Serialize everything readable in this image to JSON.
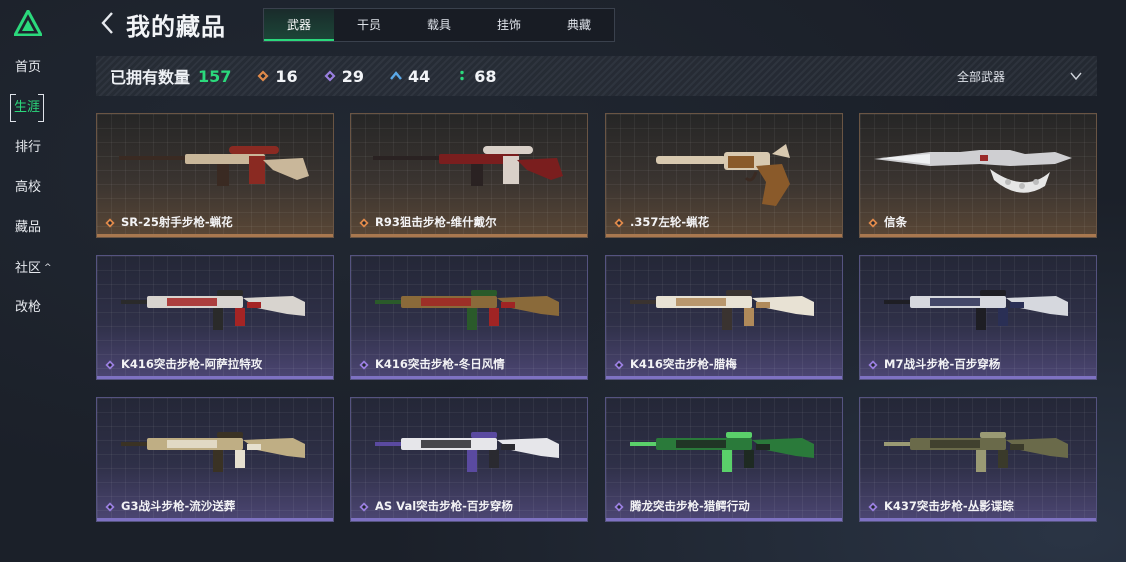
{
  "sidebar": {
    "items": [
      {
        "label": "首页",
        "active": false
      },
      {
        "label": "生涯",
        "active": true
      },
      {
        "label": "排行",
        "active": false
      },
      {
        "label": "高校",
        "active": false
      },
      {
        "label": "藏品",
        "active": false
      },
      {
        "label": "社区",
        "active": false,
        "caret": "^"
      },
      {
        "label": "改枪",
        "active": false
      }
    ]
  },
  "header": {
    "title": "我的藏品",
    "tabs": [
      {
        "label": "武器",
        "active": true
      },
      {
        "label": "干员",
        "active": false
      },
      {
        "label": "载具",
        "active": false
      },
      {
        "label": "挂饰",
        "active": false
      },
      {
        "label": "典藏",
        "active": false
      }
    ]
  },
  "summary": {
    "owned_label": "已拥有数量",
    "owned_total": "157",
    "counts": [
      {
        "icon": "orange-diamond-icon",
        "value": "16",
        "color": "#e08a4a"
      },
      {
        "icon": "purple-diamond-icon",
        "value": "29",
        "color": "#9a7fe0"
      },
      {
        "icon": "blue-chevron-icon",
        "value": "44",
        "color": "#5aa8e8"
      },
      {
        "icon": "green-dots-icon",
        "value": "68",
        "color": "#2bd97c"
      }
    ],
    "filter_label": "全部武器"
  },
  "colors": {
    "accent": "#2bd97c",
    "orange_rarity": "#e08a4a",
    "purple_rarity": "#9a7fe0"
  },
  "items": [
    {
      "name": "SR-25射手步枪-蝋花",
      "rarity": "orange",
      "kind": "sniper"
    },
    {
      "name": "R93狙击步枪-维什戴尔",
      "rarity": "orange",
      "kind": "sniper-red"
    },
    {
      "name": ".357左轮-蝋花",
      "rarity": "orange",
      "kind": "revolver"
    },
    {
      "name": "信条",
      "rarity": "orange",
      "kind": "knife"
    },
    {
      "name": "K416突击步枪-阿萨拉特攻",
      "rarity": "purple",
      "kind": "rifle-red"
    },
    {
      "name": "K416突击步枪-冬日风情",
      "rarity": "purple",
      "kind": "rifle-xmas"
    },
    {
      "name": "K416突击步枪-腊梅",
      "rarity": "purple",
      "kind": "rifle-white"
    },
    {
      "name": "M7战斗步枪-百步穿杨",
      "rarity": "purple",
      "kind": "rifle-navy"
    },
    {
      "name": "G3战斗步枪-流沙送葬",
      "rarity": "purple",
      "kind": "rifle-gold"
    },
    {
      "name": "AS Val突击步枪-百步穿杨",
      "rarity": "purple",
      "kind": "rifle-bw"
    },
    {
      "name": "腾龙突击步枪-猎鳄行动",
      "rarity": "purple",
      "kind": "rifle-green"
    },
    {
      "name": "K437突击步枪-丛影谍踪",
      "rarity": "purple",
      "kind": "rifle-camo"
    }
  ]
}
